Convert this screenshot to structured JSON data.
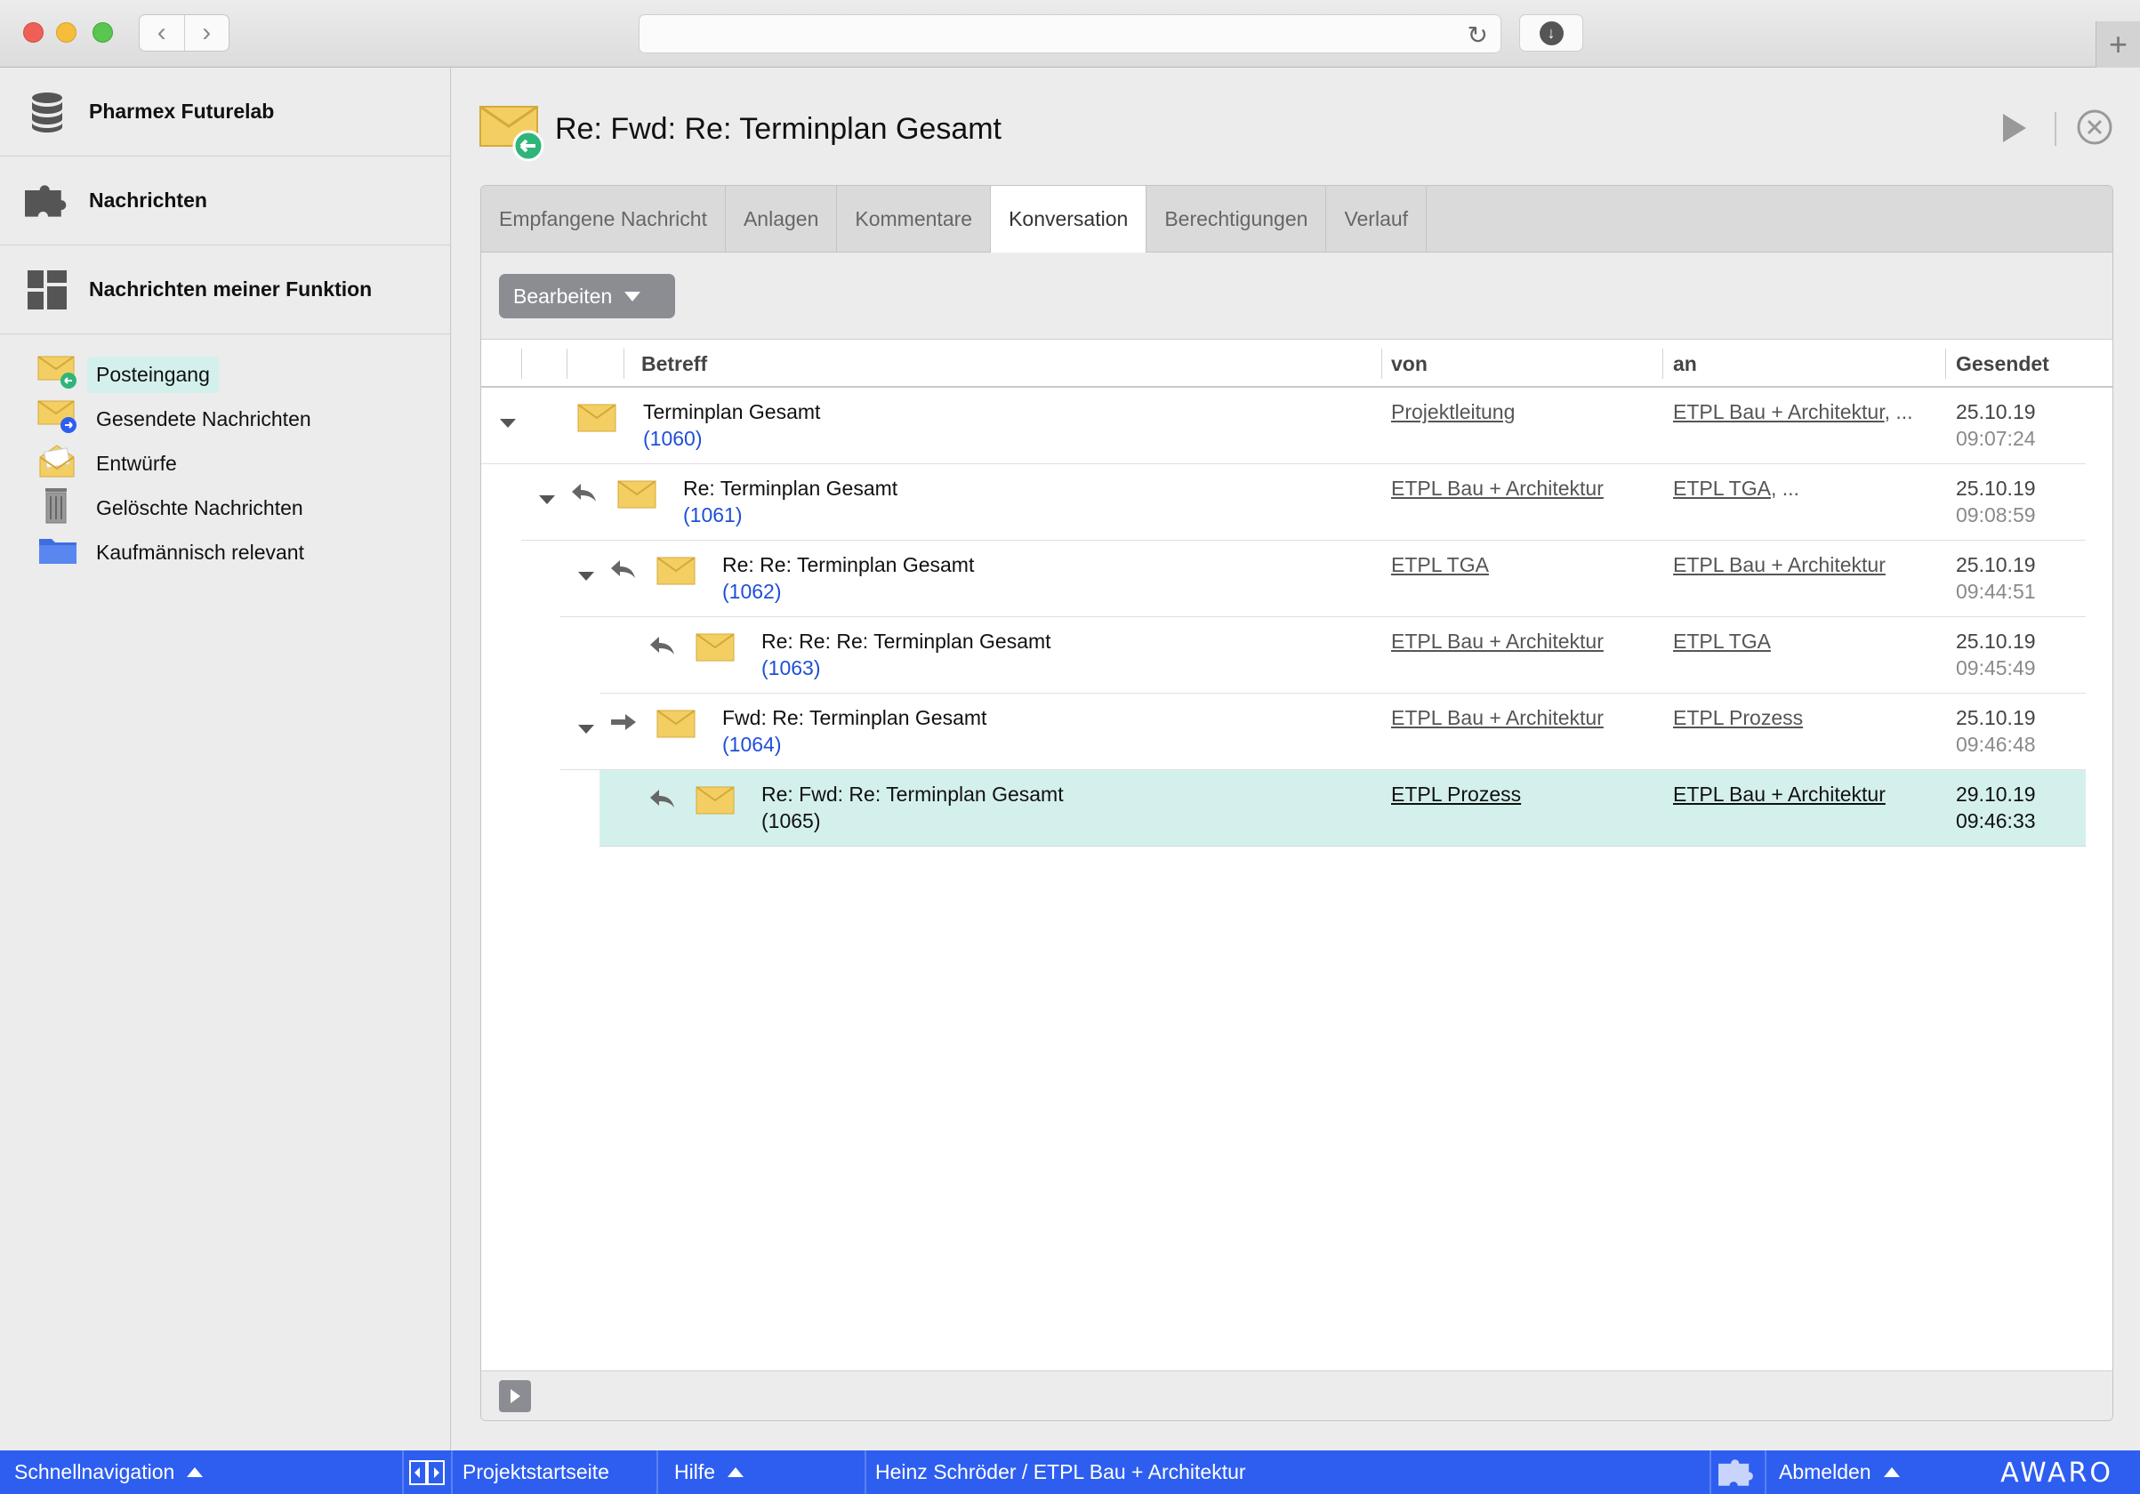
{
  "sidebar": {
    "sections": [
      {
        "label": "Pharmex Futurelab",
        "icon": "database-icon"
      },
      {
        "label": "Nachrichten",
        "icon": "puzzle-icon"
      },
      {
        "label": "Nachrichten meiner Funktion",
        "icon": "grid-icon"
      }
    ],
    "folders": [
      {
        "label": "Posteingang",
        "icon": "inbox-icon",
        "active": true
      },
      {
        "label": "Gesendete Nachrichten",
        "icon": "sent-icon"
      },
      {
        "label": "Entwürfe",
        "icon": "drafts-icon"
      },
      {
        "label": "Gelöschte Nachrichten",
        "icon": "trash-icon"
      },
      {
        "label": "Kaufmännisch relevant",
        "icon": "folder-icon"
      }
    ]
  },
  "header": {
    "title": "Re: Fwd: Re: Terminplan Gesamt"
  },
  "tabs": [
    {
      "label": "Empfangene Nachricht"
    },
    {
      "label": "Anlagen"
    },
    {
      "label": "Kommentare"
    },
    {
      "label": "Konversation",
      "active": true
    },
    {
      "label": "Berechtigungen"
    },
    {
      "label": "Verlauf"
    }
  ],
  "toolbar": {
    "edit_label": "Bearbeiten"
  },
  "table": {
    "columns": {
      "subject": "Betreff",
      "from": "von",
      "to": "an",
      "sent": "Gesendet"
    },
    "rows": [
      {
        "subject": "Terminplan Gesamt",
        "num": "(1060)",
        "from": "Projektleitung",
        "to": "ETPL Bau + Architektur",
        "to_more": ", ...",
        "date": "25.10.19",
        "time": "09:07:24",
        "type": "root"
      },
      {
        "subject": "Re: Terminplan Gesamt",
        "num": "(1061)",
        "from": "ETPL Bau + Architektur",
        "to": "ETPL TGA",
        "to_more": ", ...",
        "date": "25.10.19",
        "time": "09:08:59",
        "type": "reply"
      },
      {
        "subject": "Re: Re: Terminplan Gesamt",
        "num": "(1062)",
        "from": "ETPL TGA",
        "to": "ETPL Bau + Architektur",
        "to_more": "",
        "date": "25.10.19",
        "time": "09:44:51",
        "type": "reply"
      },
      {
        "subject": "Re: Re: Re: Terminplan Gesamt",
        "num": "(1063)",
        "from": "ETPL Bau + Architektur",
        "to": "ETPL TGA",
        "to_more": "",
        "date": "25.10.19",
        "time": "09:45:49",
        "type": "reply"
      },
      {
        "subject": "Fwd: Re: Terminplan Gesamt",
        "num": "(1064)",
        "from": "ETPL Bau + Architektur",
        "to": "ETPL Prozess",
        "to_more": "",
        "date": "25.10.19",
        "time": "09:46:48",
        "type": "forward"
      },
      {
        "subject": "Re: Fwd: Re: Terminplan Gesamt",
        "num": "(1065)",
        "from": "ETPL Prozess",
        "to": "ETPL Bau + Architektur",
        "to_more": "",
        "date": "29.10.19",
        "time": "09:46:33",
        "type": "reply",
        "selected": true
      }
    ]
  },
  "bottombar": {
    "quicknav": "Schnellnavigation",
    "project_home": "Projektstartseite",
    "help": "Hilfe",
    "user": "Heinz Schröder / ETPL Bau + Architektur",
    "logout": "Abmelden",
    "logo": "AWARO"
  },
  "colors": {
    "accent": "#2e5ef0",
    "selected_row": "#d4f0ec",
    "link_number": "#1f4fd8"
  }
}
